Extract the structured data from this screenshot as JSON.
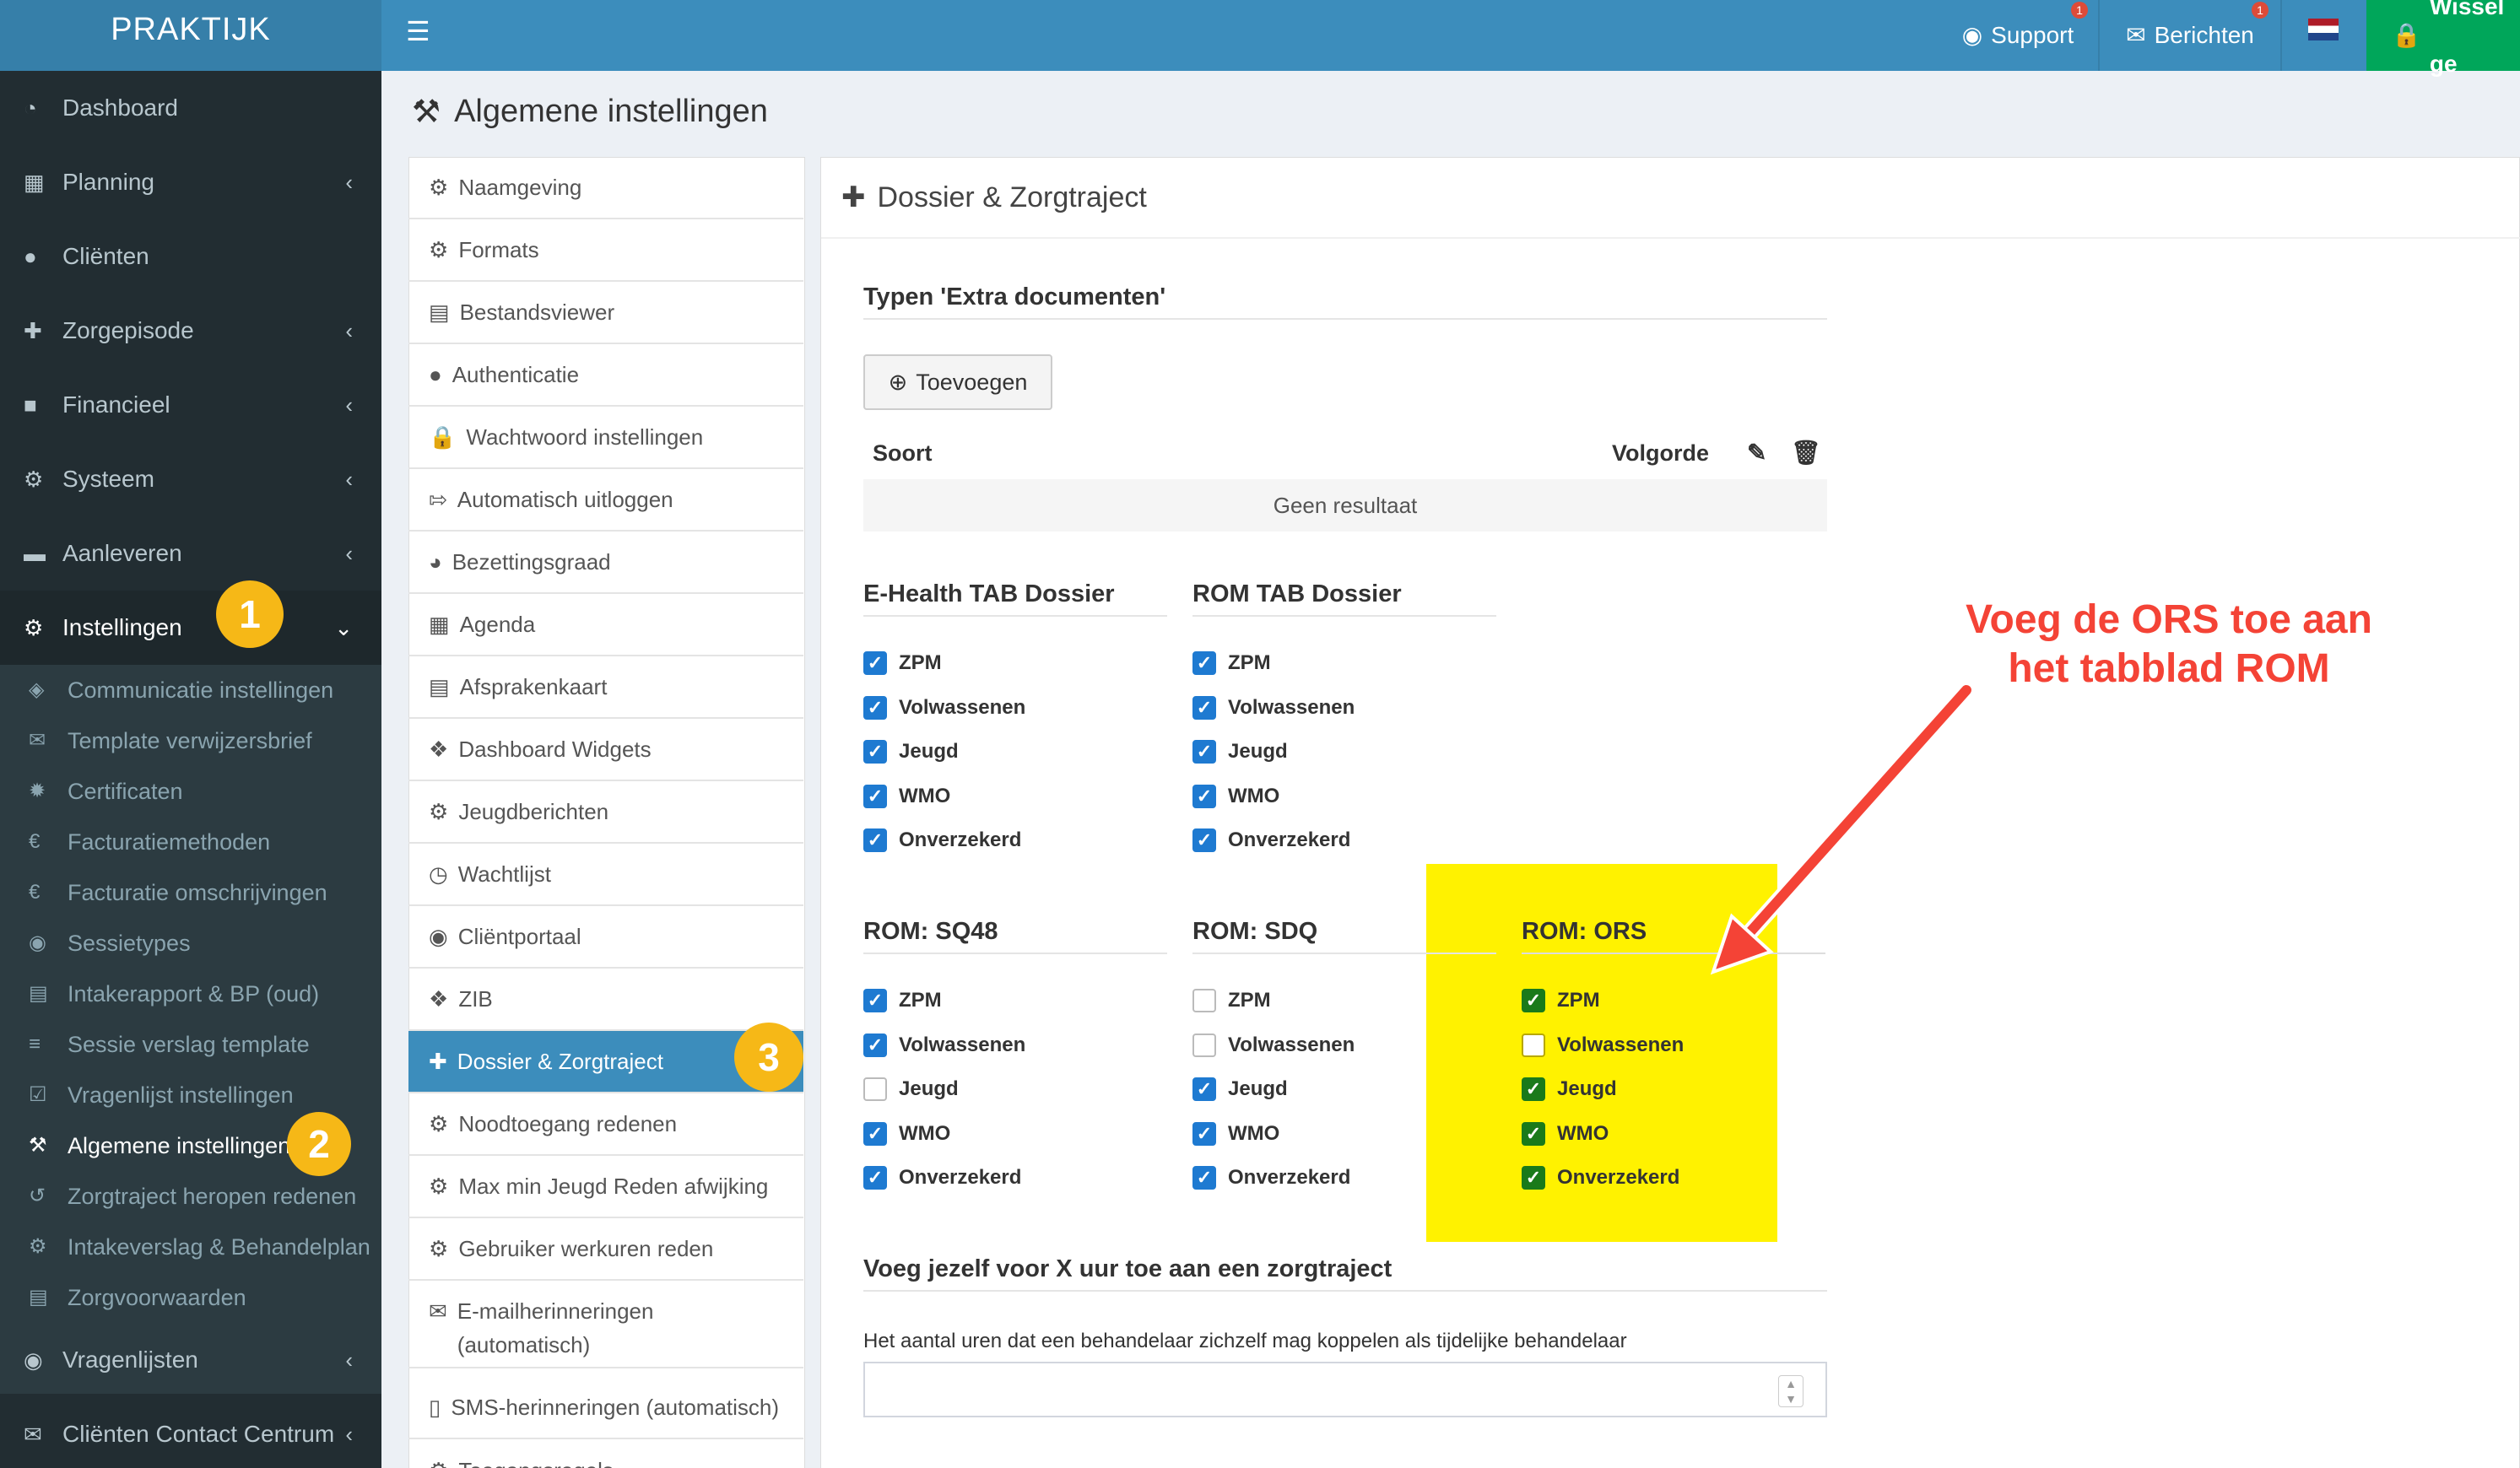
{
  "app": {
    "logo": "PRAKTIJK"
  },
  "topbar": {
    "support_label": "Support",
    "support_badge": "1",
    "berichten_label": "Berichten",
    "berichten_badge": "1",
    "wissel_label": "Wissel ge"
  },
  "sidebar": {
    "items": [
      {
        "label": "Dashboard",
        "icon": "dashboard-icon"
      },
      {
        "label": "Planning",
        "icon": "calendar-icon"
      },
      {
        "label": "Cliënten",
        "icon": "user-icon"
      },
      {
        "label": "Zorgepisode",
        "icon": "medkit-icon"
      },
      {
        "label": "Financieel",
        "icon": "book-icon"
      },
      {
        "label": "Systeem",
        "icon": "cogs-icon"
      },
      {
        "label": "Aanleveren",
        "icon": "truck-icon"
      },
      {
        "label": "Instellingen",
        "icon": "gear-icon"
      },
      {
        "label": "Vragenlijsten",
        "icon": "globe-icon"
      },
      {
        "label": "Cliënten Contact Centrum",
        "icon": "envelope-icon"
      }
    ],
    "subitems": [
      {
        "label": "Communicatie instellingen",
        "icon": "comments-icon"
      },
      {
        "label": "Template verwijzersbrief",
        "icon": "envelope-icon"
      },
      {
        "label": "Certificaten",
        "icon": "certificate-icon"
      },
      {
        "label": "Facturatiemethoden",
        "icon": "euro-icon"
      },
      {
        "label": "Facturatie omschrijvingen",
        "icon": "euro-icon"
      },
      {
        "label": "Sessietypes",
        "icon": "globe-icon"
      },
      {
        "label": "Intakerapport & BP (oud)",
        "icon": "file-icon"
      },
      {
        "label": "Sessie verslag template",
        "icon": "list-icon"
      },
      {
        "label": "Vragenlijst instellingen",
        "icon": "check-square-icon"
      },
      {
        "label": "Algemene instellingen",
        "icon": "wrench-icon"
      },
      {
        "label": "Zorgtraject heropen redenen",
        "icon": "undo-icon"
      },
      {
        "label": "Intakeverslag & Behandelplan",
        "icon": "cogs-icon"
      },
      {
        "label": "Zorgvoorwaarden",
        "icon": "file-icon"
      }
    ],
    "marker_1": "1",
    "marker_2": "2"
  },
  "page": {
    "title": "Algemene instellingen"
  },
  "settings_menu": {
    "items": [
      {
        "label": "Naamgeving",
        "icon": "gear-icon"
      },
      {
        "label": "Formats",
        "icon": "gear-icon"
      },
      {
        "label": "Bestandsviewer",
        "icon": "file-icon"
      },
      {
        "label": "Authenticatie",
        "icon": "user-icon"
      },
      {
        "label": "Wachtwoord instellingen",
        "icon": "lock-icon"
      },
      {
        "label": "Automatisch uitloggen",
        "icon": "sign-out-icon"
      },
      {
        "label": "Bezettingsgraad",
        "icon": "pie-chart-icon"
      },
      {
        "label": "Agenda",
        "icon": "calendar-icon"
      },
      {
        "label": "Afsprakenkaart",
        "icon": "list-alt-icon"
      },
      {
        "label": "Dashboard Widgets",
        "icon": "puzzle-icon"
      },
      {
        "label": "Jeugdberichten",
        "icon": "gear-icon"
      },
      {
        "label": "Wachtlijst",
        "icon": "clock-icon"
      },
      {
        "label": "Cliëntportaal",
        "icon": "globe-icon"
      },
      {
        "label": "ZIB",
        "icon": "puzzle-icon"
      },
      {
        "label": "Dossier & Zorgtraject",
        "icon": "medkit-icon"
      },
      {
        "label": "Noodtoegang redenen",
        "icon": "gear-icon"
      },
      {
        "label": "Max min Jeugd Reden afwijking",
        "icon": "gear-icon"
      },
      {
        "label": "Gebruiker werkuren reden",
        "icon": "gear-icon"
      },
      {
        "label": "E-mailherinneringen (automatisch)",
        "icon": "envelope-icon"
      },
      {
        "label": "SMS-herinneringen (automatisch)",
        "icon": "mobile-icon"
      },
      {
        "label": "Toegangsregels",
        "icon": "gear-icon"
      }
    ],
    "marker_3": "3"
  },
  "panel": {
    "title": "Dossier & Zorgtraject",
    "extra_docs": {
      "heading": "Typen 'Extra documenten'",
      "add_button": "Toevoegen",
      "col_soort": "Soort",
      "col_volgorde": "Volgorde",
      "empty": "Geen resultaat"
    },
    "groups": [
      {
        "title": "E-Health TAB Dossier",
        "options": [
          {
            "label": "ZPM",
            "checked": true
          },
          {
            "label": "Volwassenen",
            "checked": true
          },
          {
            "label": "Jeugd",
            "checked": true
          },
          {
            "label": "WMO",
            "checked": true
          },
          {
            "label": "Onverzekerd",
            "checked": true
          }
        ]
      },
      {
        "title": "ROM TAB Dossier",
        "options": [
          {
            "label": "ZPM",
            "checked": true
          },
          {
            "label": "Volwassenen",
            "checked": true
          },
          {
            "label": "Jeugd",
            "checked": true
          },
          {
            "label": "WMO",
            "checked": true
          },
          {
            "label": "Onverzekerd",
            "checked": true
          }
        ]
      },
      {
        "title": "ROM: SQ48",
        "options": [
          {
            "label": "ZPM",
            "checked": true
          },
          {
            "label": "Volwassenen",
            "checked": true
          },
          {
            "label": "Jeugd",
            "checked": false
          },
          {
            "label": "WMO",
            "checked": true
          },
          {
            "label": "Onverzekerd",
            "checked": true
          }
        ]
      },
      {
        "title": "ROM: SDQ",
        "options": [
          {
            "label": "ZPM",
            "checked": false
          },
          {
            "label": "Volwassenen",
            "checked": false
          },
          {
            "label": "Jeugd",
            "checked": true
          },
          {
            "label": "WMO",
            "checked": true
          },
          {
            "label": "Onverzekerd",
            "checked": true
          }
        ]
      },
      {
        "title": "ROM: ORS",
        "options": [
          {
            "label": "ZPM",
            "checked": true
          },
          {
            "label": "Volwassenen",
            "checked": false
          },
          {
            "label": "Jeugd",
            "checked": true
          },
          {
            "label": "WMO",
            "checked": true
          },
          {
            "label": "Onverzekerd",
            "checked": true
          }
        ]
      }
    ],
    "self_link": {
      "heading": "Voeg jezelf voor X uur toe aan een zorgtraject",
      "hint": "Het aantal uren dat een behandelaar zichzelf mag koppelen als tijdelijke behandelaar",
      "value": ""
    }
  },
  "annotation": {
    "line1": "Voeg de ORS toe aan",
    "line2": "het tabblad ROM"
  },
  "colors": {
    "accent": "#3c8dbc",
    "sidebar": "#222d32",
    "highlight": "#fff200",
    "annotation": "#f44336",
    "wissel": "#00a65a"
  }
}
